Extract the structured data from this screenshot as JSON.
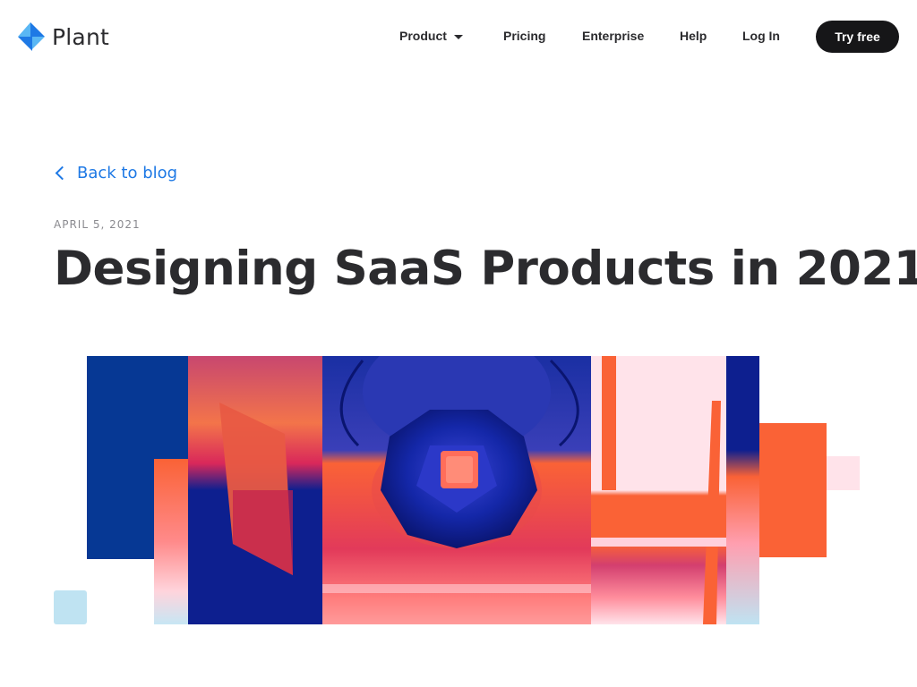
{
  "header": {
    "logo": {
      "text": "Plant",
      "icon": "plant-logo-icon",
      "colors": [
        "#1e79e5",
        "#5ab7f4"
      ]
    },
    "nav": {
      "product": "Product",
      "pricing": "Pricing",
      "enterprise": "Enterprise",
      "help": "Help",
      "login": "Log In",
      "cta": "Try free"
    }
  },
  "article": {
    "back_link": "Back to blog",
    "date": "APRIL 5, 2021",
    "title": "Designing SaaS Products in 2021",
    "hero": {
      "icon": "abstract-3d-artwork-illustration"
    }
  },
  "colors": {
    "link": "#1e79e5",
    "text": "#2b2b2e",
    "cta_bg": "#161618",
    "hero_navy": "#0d1f8f",
    "hero_orange": "#fa6236",
    "hero_pink": "#ffe3ea",
    "hero_lightblue": "#bfe3f2"
  }
}
